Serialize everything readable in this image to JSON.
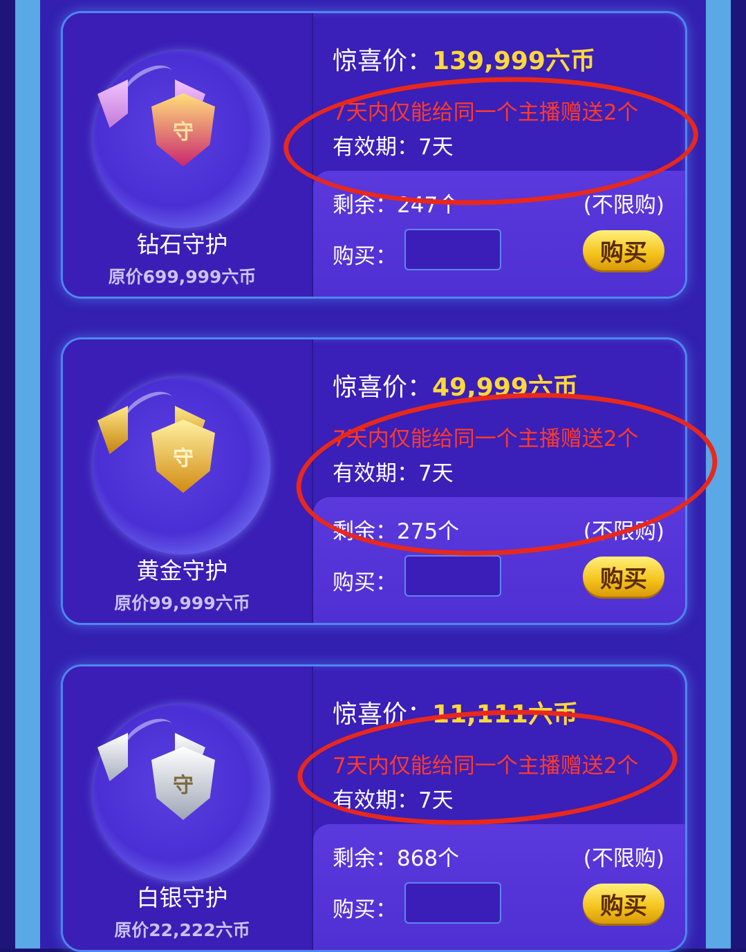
{
  "cards": [
    {
      "name": "钻石守护",
      "original_price": "原价699,999六币",
      "price_label": "惊喜价：",
      "price_value": "139,999六币",
      "notice": "7天内仅能给同一个主播赠送2个",
      "validity": "有效期：7天",
      "remaining": "剩余：247个",
      "limit": "(不限购)",
      "buy_label": "购买：",
      "buy_button": "购买",
      "badge_char": "守",
      "badge_icon": "diamond-guard-badge-icon"
    },
    {
      "name": "黄金守护",
      "original_price": "原价99,999六币",
      "price_label": "惊喜价：",
      "price_value": "49,999六币",
      "notice": "7天内仅能给同一个主播赠送2个",
      "validity": "有效期：7天",
      "remaining": "剩余：275个",
      "limit": "(不限购)",
      "buy_label": "购买：",
      "buy_button": "购买",
      "badge_char": "守",
      "badge_icon": "gold-guard-badge-icon"
    },
    {
      "name": "白银守护",
      "original_price": "原价22,222六币",
      "price_label": "惊喜价：",
      "price_value": "11,111六币",
      "notice": "7天内仅能给同一个主播赠送2个",
      "validity": "有效期：7天",
      "remaining": "剩余：868个",
      "limit": "(不限购)",
      "buy_label": "购买：",
      "buy_button": "购买",
      "badge_char": "守",
      "badge_icon": "silver-guard-badge-icon"
    }
  ],
  "colors": {
    "background": "#3320b0",
    "card_border": "#4f86f0",
    "price_value": "#ffd83a",
    "notice": "#ff3a2a",
    "annotation": "#e8281c",
    "buy_button": "#f4c21a"
  }
}
